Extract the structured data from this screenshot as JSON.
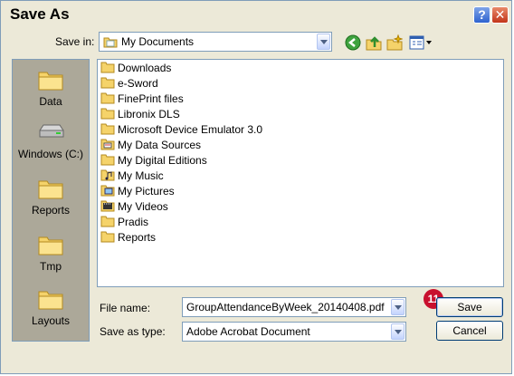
{
  "window": {
    "title": "Save As"
  },
  "toolbar": {
    "save_in_label": "Save in:",
    "save_in_value": "My Documents"
  },
  "places": [
    {
      "label": "Data",
      "icon": "folder-icon"
    },
    {
      "label": "Windows (C:)",
      "icon": "drive-icon"
    },
    {
      "label": "Reports",
      "icon": "folder-icon"
    },
    {
      "label": "Tmp",
      "icon": "folder-icon"
    },
    {
      "label": "Layouts",
      "icon": "folder-icon"
    }
  ],
  "files": [
    {
      "name": "Downloads",
      "icon": "folder-icon"
    },
    {
      "name": "e-Sword",
      "icon": "folder-icon"
    },
    {
      "name": "FinePrint files",
      "icon": "folder-icon"
    },
    {
      "name": "Libronix DLS",
      "icon": "folder-icon"
    },
    {
      "name": "Microsoft Device Emulator 3.0",
      "icon": "folder-icon"
    },
    {
      "name": "My Data Sources",
      "icon": "data-folder-icon"
    },
    {
      "name": "My Digital Editions",
      "icon": "folder-icon"
    },
    {
      "name": "My Music",
      "icon": "music-folder-icon"
    },
    {
      "name": "My Pictures",
      "icon": "pictures-folder-icon"
    },
    {
      "name": "My Videos",
      "icon": "video-folder-icon"
    },
    {
      "name": "Pradis",
      "icon": "folder-icon"
    },
    {
      "name": "Reports",
      "icon": "folder-icon"
    }
  ],
  "form": {
    "file_name_label": "File name:",
    "file_name_value": "GroupAttendanceByWeek_20140408.pdf",
    "save_as_type_label": "Save as type:",
    "save_as_type_value": "Adobe Acrobat Document"
  },
  "buttons": {
    "save": "Save",
    "cancel": "Cancel"
  },
  "marker": {
    "number": "11"
  },
  "colors": {
    "folder": "#f5d36a",
    "marker": "#c8102e",
    "places_bg": "#aca899"
  }
}
